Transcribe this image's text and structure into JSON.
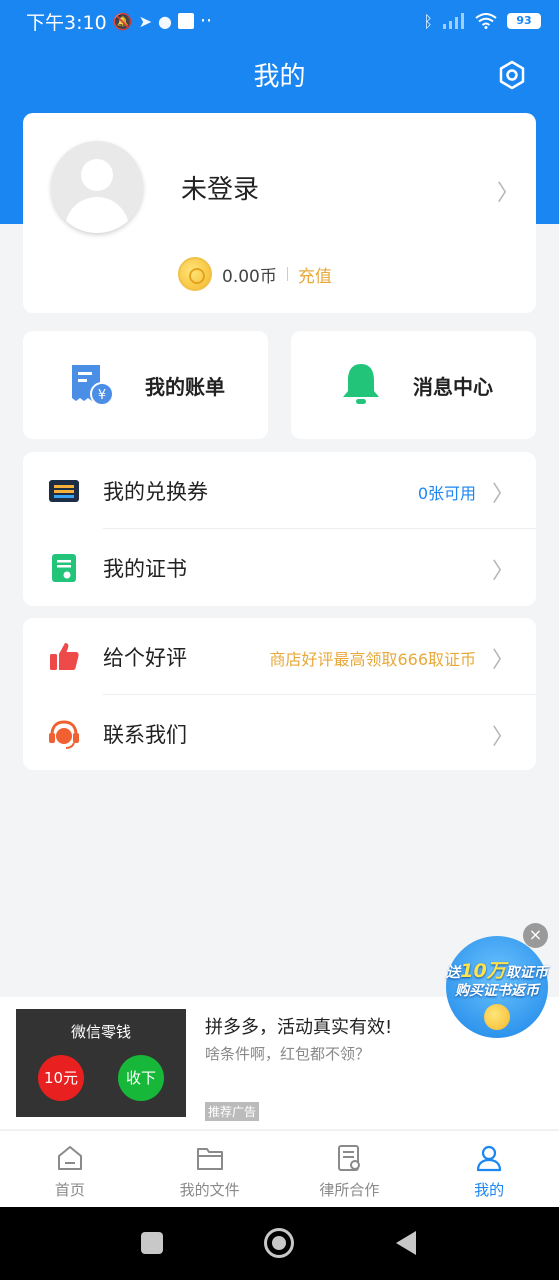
{
  "status_bar": {
    "time": "下午3:10",
    "dots": "··",
    "battery": "93"
  },
  "header": {
    "title": "我的"
  },
  "profile": {
    "login_text": "未登录",
    "balance": "0.00币",
    "recharge_label": "充值"
  },
  "quick_actions": {
    "bills_label": "我的账单",
    "messages_label": "消息中心"
  },
  "list_group_1": [
    {
      "label": "我的兑换券",
      "note": "0张可用"
    },
    {
      "label": "我的证书",
      "note": ""
    }
  ],
  "list_group_2": [
    {
      "label": "给个好评",
      "note": "商店好评最高领取666取证币"
    },
    {
      "label": "联系我们",
      "note": ""
    }
  ],
  "ad": {
    "thumb_title": "微信零钱",
    "thumb_left_button": "10元",
    "thumb_right_button": "收下",
    "title": "拼多多，活动真实有效!",
    "subtitle": "啥条件啊，红包都不领？",
    "tag": "推荐广告"
  },
  "promo": {
    "line1_prefix": "送",
    "line1_big": "10万",
    "line1_suffix": "取证币",
    "line2": "购买证书返币",
    "close": "×"
  },
  "tabs": [
    {
      "label": "首页",
      "icon": "home-icon",
      "active": false
    },
    {
      "label": "我的文件",
      "icon": "folder-icon",
      "active": false
    },
    {
      "label": "律所合作",
      "icon": "document-icon",
      "active": false
    },
    {
      "label": "我的",
      "icon": "user-icon",
      "active": true
    }
  ],
  "colors": {
    "primary": "#1a86f2",
    "accent_orange": "#e8a93a",
    "note_blue": "#1a86f2"
  }
}
